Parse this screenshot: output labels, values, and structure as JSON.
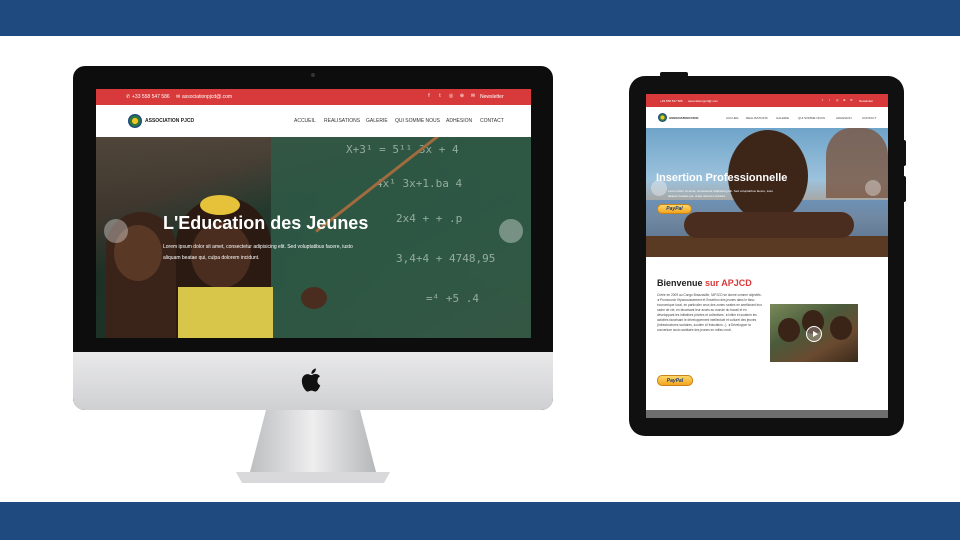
{
  "colors": {
    "brand_blue": "#1f4a80",
    "accent_red": "#d8393a",
    "text_dark": "#222222"
  },
  "desktop": {
    "topbar": {
      "phone": "+33 558 547 586",
      "email": "associationpjcd@.com",
      "social": [
        "f",
        "t",
        "◎",
        "⊕",
        "✉"
      ],
      "newsletter": "Newsletter"
    },
    "logo_text": "ASSOCIATION PJCD",
    "menu": [
      "ACCUEIL",
      "REALISATIONS",
      "GALERIE",
      "QUI SOMME NOUS",
      "ADHESION",
      "CONTACT"
    ],
    "hero": {
      "title": "L'Education des Jeunes",
      "subtitle": "Lorem ipsum dolor sit amet, consectetur adipisicing elit. Sed voluptatibus facere, iusto aliquam beatae qui, culpa dolorem incidunt.",
      "chalk_lines": [
        "X+3¹ = 5¹¹ 3x + 4",
        "4x¹ 3x+1.ba 4",
        "2x4 + + .p",
        "3,4+4 + 4748,95",
        "=⁴ +5 .4"
      ]
    }
  },
  "tablet": {
    "topbar": {
      "phone": "+33 558 547 586",
      "email": "associationpjcd@.com",
      "social": [
        "f",
        "t",
        "◎",
        "⊕",
        "✉"
      ],
      "newsletter": "Newsletter"
    },
    "logo_text": "ASSOCIATION PJCD",
    "menu": [
      "ACCUEIL",
      "REALISATIONS",
      "GALERIE",
      "QUI SOMME NOUS",
      "ADHESION",
      "CONTACT"
    ],
    "hero": {
      "title": "Insertion Professionnelle",
      "subtitle": "Lorem dolor sit amet, consectetur adipisicing elit. Sed voluptatibus facere, iusto aliquam beatae qui, culpa dolorem incidunt.",
      "paypal": "PayPal"
    },
    "welcome": {
      "title_start": "Bienvenue",
      "title_accent": "sur APJCD",
      "paragraph": "Créée en 2009 au Congo Brazzaville, l'APJCD se donne comme objectifs : ★Promouvoir l'épanouissement et l'insertion des jeunes dans le tissu économique local, en particulier ceux des zones rurales en améliorant leur cadre de vie, en favorisant leur accès au monde du travail et en développant les initiatives privées et collectives. ★Initier et soutenir les activités favorisant le développement intellectuel et culturel des jeunes (Infrastructures scolaires, soutien à l'éducation...). ★Développer la couverture socio-sanitaire des jeunes en milieu rural.",
      "paypal": "PayPal"
    }
  }
}
